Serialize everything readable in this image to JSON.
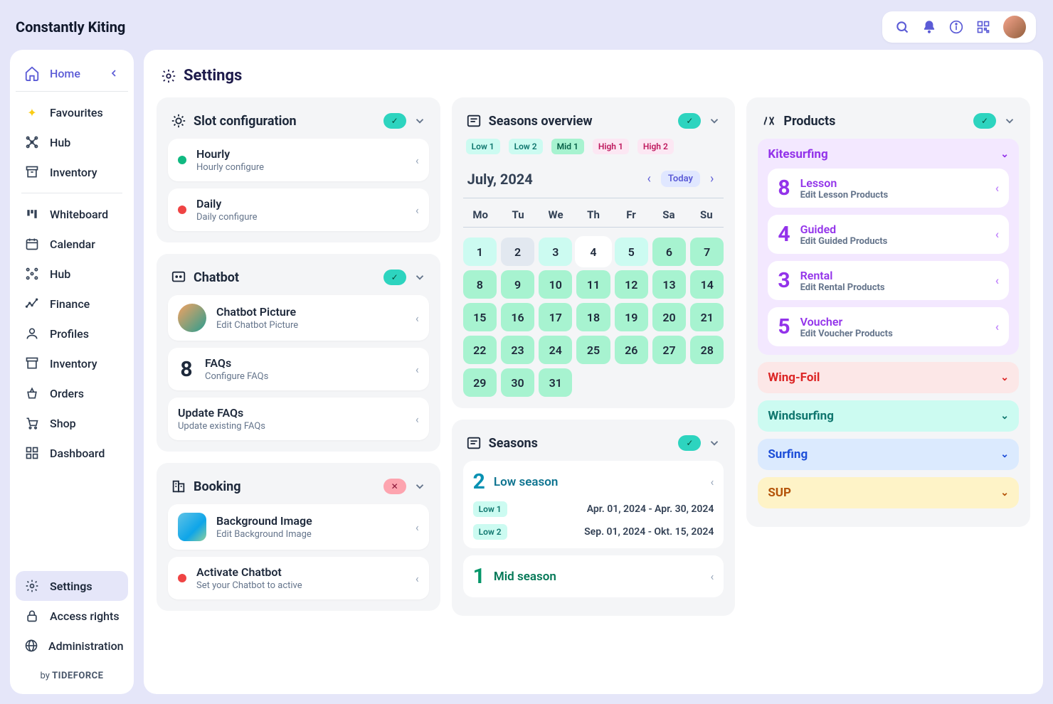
{
  "brand": "Constantly Kiting",
  "footer": {
    "prefix": "by ",
    "name": "TIDEFORCE"
  },
  "nav": {
    "home": "Home",
    "items": [
      "Favourites",
      "Hub",
      "Inventory"
    ],
    "items2": [
      "Whiteboard",
      "Calendar",
      "Hub",
      "Finance",
      "Profiles",
      "Inventory",
      "Orders",
      "Shop",
      "Dashboard"
    ],
    "bottom": [
      "Settings",
      "Access rights",
      "Administration"
    ]
  },
  "page": {
    "title": "Settings"
  },
  "slot": {
    "title": "Slot configuration",
    "items": [
      {
        "title": "Hourly",
        "sub": "Hourly configure",
        "dot": "green"
      },
      {
        "title": "Daily",
        "sub": "Daily configure",
        "dot": "red"
      }
    ]
  },
  "chatbot": {
    "title": "Chatbot",
    "pic": {
      "title": "Chatbot Picture",
      "sub": "Edit Chatbot Picture"
    },
    "faqs": {
      "n": "8",
      "title": "FAQs",
      "sub": "Configure FAQs"
    },
    "update": {
      "title": "Update FAQs",
      "sub": "Update existing FAQs"
    }
  },
  "booking": {
    "title": "Booking",
    "bg": {
      "title": "Background Image",
      "sub": "Edit Background Image"
    },
    "act": {
      "title": "Activate Chatbot",
      "sub": "Set your Chatbot to active"
    }
  },
  "overview": {
    "title": "Seasons overview",
    "legend": [
      "Low 1",
      "Low 2",
      "Mid 1",
      "High 1",
      "High 2"
    ],
    "month": "July, 2024",
    "today": "Today",
    "dow": [
      "Mo",
      "Tu",
      "We",
      "Th",
      "Fr",
      "Sa",
      "Su"
    ],
    "days": [
      1,
      2,
      3,
      4,
      5,
      6,
      7,
      8,
      9,
      10,
      11,
      12,
      13,
      14,
      15,
      16,
      17,
      18,
      19,
      20,
      21,
      22,
      23,
      24,
      25,
      26,
      27,
      28,
      29,
      30,
      31
    ]
  },
  "seasons": {
    "title": "Seasons",
    "low": {
      "n": "2",
      "name": "Low season",
      "rows": [
        {
          "label": "Low 1",
          "dates": "Apr. 01, 2024 - Apr. 30, 2024"
        },
        {
          "label": "Low 2",
          "dates": "Sep. 01, 2024 - Okt. 15, 2024"
        }
      ]
    },
    "mid": {
      "n": "1",
      "name": "Mid season"
    }
  },
  "products": {
    "title": "Products",
    "kite": {
      "name": "Kitesurfing",
      "items": [
        {
          "n": "8",
          "title": "Lesson",
          "sub": "Edit Lesson Products"
        },
        {
          "n": "4",
          "title": "Guided",
          "sub": "Edit Guided Products"
        },
        {
          "n": "3",
          "title": "Rental",
          "sub": "Edit Rental Products"
        },
        {
          "n": "5",
          "title": "Voucher",
          "sub": "Edit Voucher Products"
        }
      ]
    },
    "groups": [
      "Wing-Foil",
      "Windsurfing",
      "Surfing",
      "SUP"
    ]
  }
}
